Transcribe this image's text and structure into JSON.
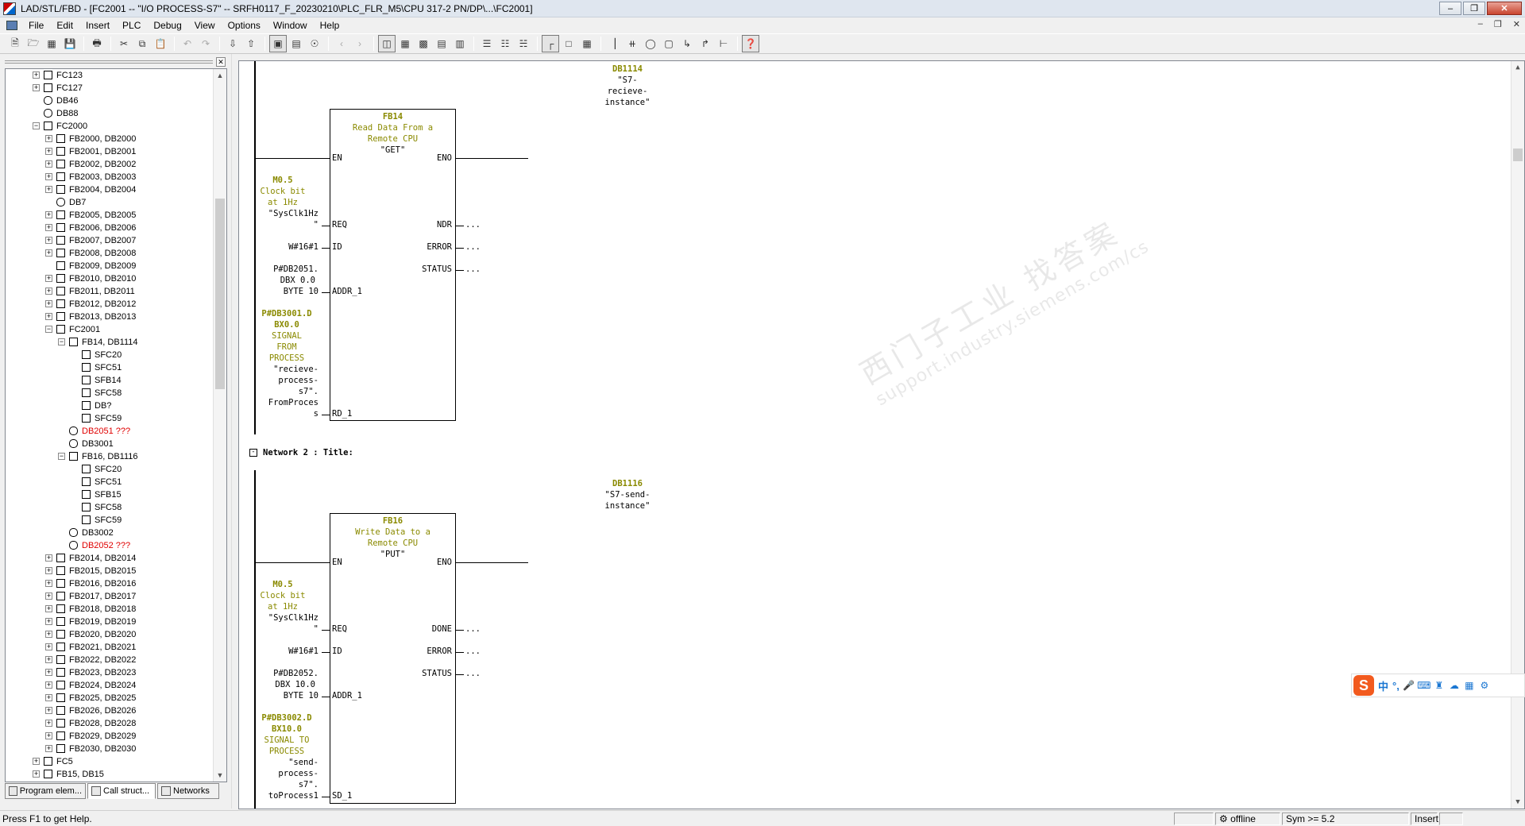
{
  "window": {
    "title": "LAD/STL/FBD  - [FC2001 -- \"I/O PROCESS-S7\" -- SRFH0117_F_20230210\\PLC_FLR_M5\\CPU 317-2 PN/DP\\...\\FC2001]"
  },
  "menu": [
    "File",
    "Edit",
    "Insert",
    "PLC",
    "Debug",
    "View",
    "Options",
    "Window",
    "Help"
  ],
  "tree": {
    "items": [
      {
        "depth": 0,
        "exp": "+",
        "type": "fb",
        "label": "FC123"
      },
      {
        "depth": 0,
        "exp": "+",
        "type": "fb",
        "label": "FC127"
      },
      {
        "depth": 0,
        "exp": "",
        "type": "db",
        "label": "DB46"
      },
      {
        "depth": 0,
        "exp": "",
        "type": "db",
        "label": "DB88"
      },
      {
        "depth": 0,
        "exp": "-",
        "type": "fb",
        "label": "FC2000"
      },
      {
        "depth": 1,
        "exp": "+",
        "type": "fb",
        "label": "FB2000, DB2000"
      },
      {
        "depth": 1,
        "exp": "+",
        "type": "fb",
        "label": "FB2001, DB2001"
      },
      {
        "depth": 1,
        "exp": "+",
        "type": "fb",
        "label": "FB2002, DB2002"
      },
      {
        "depth": 1,
        "exp": "+",
        "type": "fb",
        "label": "FB2003, DB2003"
      },
      {
        "depth": 1,
        "exp": "+",
        "type": "fb",
        "label": "FB2004, DB2004"
      },
      {
        "depth": 1,
        "exp": "",
        "type": "db",
        "label": "DB7"
      },
      {
        "depth": 1,
        "exp": "+",
        "type": "fb",
        "label": "FB2005, DB2005"
      },
      {
        "depth": 1,
        "exp": "+",
        "type": "fb",
        "label": "FB2006, DB2006"
      },
      {
        "depth": 1,
        "exp": "+",
        "type": "fb",
        "label": "FB2007, DB2007"
      },
      {
        "depth": 1,
        "exp": "+",
        "type": "fb",
        "label": "FB2008, DB2008"
      },
      {
        "depth": 1,
        "exp": "",
        "type": "fb",
        "label": "FB2009, DB2009"
      },
      {
        "depth": 1,
        "exp": "+",
        "type": "fb",
        "label": "FB2010, DB2010"
      },
      {
        "depth": 1,
        "exp": "+",
        "type": "fb",
        "label": "FB2011, DB2011"
      },
      {
        "depth": 1,
        "exp": "+",
        "type": "fb",
        "label": "FB2012, DB2012"
      },
      {
        "depth": 1,
        "exp": "+",
        "type": "fb",
        "label": "FB2013, DB2013"
      },
      {
        "depth": 1,
        "exp": "-",
        "type": "fb",
        "label": "FC2001"
      },
      {
        "depth": 2,
        "exp": "-",
        "type": "fb",
        "label": "FB14, DB1114"
      },
      {
        "depth": 3,
        "exp": "",
        "type": "fb",
        "label": "SFC20"
      },
      {
        "depth": 3,
        "exp": "",
        "type": "fb",
        "label": "SFC51"
      },
      {
        "depth": 3,
        "exp": "",
        "type": "fb",
        "label": "SFB14"
      },
      {
        "depth": 3,
        "exp": "",
        "type": "fb",
        "label": "SFC58"
      },
      {
        "depth": 3,
        "exp": "",
        "type": "fb",
        "label": "DB?"
      },
      {
        "depth": 3,
        "exp": "",
        "type": "fb",
        "label": "SFC59"
      },
      {
        "depth": 2,
        "exp": "",
        "type": "db",
        "label": "DB2051 ???",
        "red": true
      },
      {
        "depth": 2,
        "exp": "",
        "type": "db",
        "label": "DB3001"
      },
      {
        "depth": 2,
        "exp": "-",
        "type": "fb",
        "label": "FB16, DB1116"
      },
      {
        "depth": 3,
        "exp": "",
        "type": "fb",
        "label": "SFC20"
      },
      {
        "depth": 3,
        "exp": "",
        "type": "fb",
        "label": "SFC51"
      },
      {
        "depth": 3,
        "exp": "",
        "type": "fb",
        "label": "SFB15"
      },
      {
        "depth": 3,
        "exp": "",
        "type": "fb",
        "label": "SFC58"
      },
      {
        "depth": 3,
        "exp": "",
        "type": "fb",
        "label": "SFC59"
      },
      {
        "depth": 2,
        "exp": "",
        "type": "db",
        "label": "DB3002"
      },
      {
        "depth": 2,
        "exp": "",
        "type": "db",
        "label": "DB2052 ???",
        "red": true
      },
      {
        "depth": 1,
        "exp": "+",
        "type": "fb",
        "label": "FB2014, DB2014"
      },
      {
        "depth": 1,
        "exp": "+",
        "type": "fb",
        "label": "FB2015, DB2015"
      },
      {
        "depth": 1,
        "exp": "+",
        "type": "fb",
        "label": "FB2016, DB2016"
      },
      {
        "depth": 1,
        "exp": "+",
        "type": "fb",
        "label": "FB2017, DB2017"
      },
      {
        "depth": 1,
        "exp": "+",
        "type": "fb",
        "label": "FB2018, DB2018"
      },
      {
        "depth": 1,
        "exp": "+",
        "type": "fb",
        "label": "FB2019, DB2019"
      },
      {
        "depth": 1,
        "exp": "+",
        "type": "fb",
        "label": "FB2020, DB2020"
      },
      {
        "depth": 1,
        "exp": "+",
        "type": "fb",
        "label": "FB2021, DB2021"
      },
      {
        "depth": 1,
        "exp": "+",
        "type": "fb",
        "label": "FB2022, DB2022"
      },
      {
        "depth": 1,
        "exp": "+",
        "type": "fb",
        "label": "FB2023, DB2023"
      },
      {
        "depth": 1,
        "exp": "+",
        "type": "fb",
        "label": "FB2024, DB2024"
      },
      {
        "depth": 1,
        "exp": "+",
        "type": "fb",
        "label": "FB2025, DB2025"
      },
      {
        "depth": 1,
        "exp": "+",
        "type": "fb",
        "label": "FB2026, DB2026"
      },
      {
        "depth": 1,
        "exp": "+",
        "type": "fb",
        "label": "FB2028, DB2028"
      },
      {
        "depth": 1,
        "exp": "+",
        "type": "fb",
        "label": "FB2029, DB2029"
      },
      {
        "depth": 1,
        "exp": "+",
        "type": "fb",
        "label": "FB2030, DB2030"
      },
      {
        "depth": 0,
        "exp": "+",
        "type": "fb",
        "label": "FC5"
      },
      {
        "depth": 0,
        "exp": "+",
        "type": "fb",
        "label": "FB15, DB15"
      }
    ]
  },
  "tabs": [
    "Program elem...",
    "Call struct...",
    "Networks"
  ],
  "net1": {
    "instance": "DB1114",
    "instance_sym": [
      "\"S7-",
      "recieve-",
      "instance\""
    ],
    "block": "FB14",
    "block_desc": [
      "Read Data From a",
      "Remote CPU"
    ],
    "block_sym": "\"GET\"",
    "en": "EN",
    "eno": "ENO",
    "req_comment": [
      "M0.5",
      "Clock bit",
      "at 1Hz"
    ],
    "req_sym": [
      "\"SysClk1Hz",
      "\""
    ],
    "req_pin": "REQ",
    "id_val": "W#16#1",
    "id_pin": "ID",
    "addr_val": [
      "P#DB2051.",
      "DBX 0.0",
      "BYTE 10"
    ],
    "addr_pin": "ADDR_1",
    "rd_comment": [
      "P#DB3001.D",
      "BX0.0",
      "SIGNAL",
      "FROM",
      "PROCESS"
    ],
    "rd_sym": [
      "\"recieve-",
      "process-",
      "s7\".",
      "FromProces",
      "s"
    ],
    "rd_pin": "RD_1",
    "out_pins": [
      "NDR",
      "ERROR",
      "STATUS"
    ],
    "out_val": "..."
  },
  "net2": {
    "header": "Network 2",
    "title": ": Title:",
    "instance": "DB1116",
    "instance_sym": [
      "\"S7-send-",
      "instance\""
    ],
    "block": "FB16",
    "block_desc": [
      "Write Data to a",
      "Remote CPU"
    ],
    "block_sym": "\"PUT\"",
    "en": "EN",
    "eno": "ENO",
    "req_comment": [
      "M0.5",
      "Clock bit",
      "at 1Hz"
    ],
    "req_sym": [
      "\"SysClk1Hz",
      "\""
    ],
    "req_pin": "REQ",
    "id_val": "W#16#1",
    "id_pin": "ID",
    "addr_val": [
      "P#DB2052.",
      "DBX 10.0",
      "BYTE 10"
    ],
    "addr_pin": "ADDR_1",
    "sd_comment": [
      "P#DB3002.D",
      "BX10.0",
      "SIGNAL TO",
      "PROCESS"
    ],
    "sd_sym": [
      "\"send-",
      "process-",
      "s7\".",
      "toProcess1"
    ],
    "sd_pin": "SD_1",
    "out_pins": [
      "DONE",
      "ERROR",
      "STATUS"
    ],
    "out_val": "..."
  },
  "watermark": {
    "line1": "西门子工业   找答案",
    "line2": "support.industry.siemens.com/cs"
  },
  "ime": {
    "char1": "中",
    "char2": "°,"
  },
  "status": {
    "help": "Press F1 to get Help.",
    "mode": "offline",
    "sym": "Sym >= 5.2",
    "insert": "Insert"
  }
}
